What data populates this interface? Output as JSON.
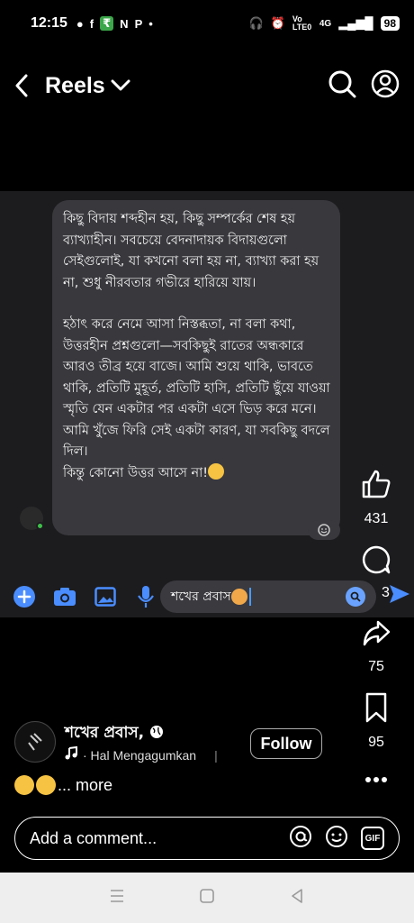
{
  "status_bar": {
    "time": "12:15",
    "left_icons": [
      "chat-icon",
      "facebook-icon",
      "app-icon",
      "n-icon",
      "p-icon",
      "dot-icon"
    ],
    "network": "Vo LTE0",
    "signal": "4G",
    "battery": "98"
  },
  "header": {
    "title": "Reels"
  },
  "video": {
    "message_paragraphs": [
      "কিছু বিদায় শব্দহীন হয়, কিছু সম্পর্কের শেষ হয় ব্যাখ্যাহীন। সবচেয়ে বেদনাদায়ক বিদায়গুলো সেইগুলোই, যা কখনো বলা হয় না, ব্যাখ্যা করা হয় না, শুধু নীরবতার গভীরে হারিয়ে যায়।",
      "হঠাৎ করে নেমে আসা নিস্তব্ধতা, না বলা কথা, উত্তরহীন প্রশ্নগুলো—সবকিছুই রাতের অন্ধকারে আরও তীব্র হয়ে বাজে। আমি শুয়ে থাকি, ভাবতে থাকি, প্রতিটি মুহূর্ত, প্রতিটি হাসি, প্রতিটি ছুঁয়ে যাওয়া স্মৃতি যেন একটার পর একটা এসে ভিড় করে মনে। আমি খুঁজে ফিরি সেই একটা কারণ, যা সবকিছু বদলে দিল।"
    ],
    "last_line": "কিন্তু কোনো উত্তর আসে না!",
    "input_text": "শখের প্রবাস"
  },
  "rail": {
    "likes": "431",
    "comments": "3",
    "shares": "75",
    "saves": "95"
  },
  "author": {
    "name": "শখের প্রবাস,",
    "music": "· Hal Mengagumkan",
    "follow_label": "Follow"
  },
  "caption": {
    "more": "... more"
  },
  "comment_box": {
    "placeholder": "Add a comment...",
    "gif_label": "GIF"
  },
  "colors": {
    "accent_blue": "#4a8dff",
    "bubble_bg": "#38383d"
  }
}
